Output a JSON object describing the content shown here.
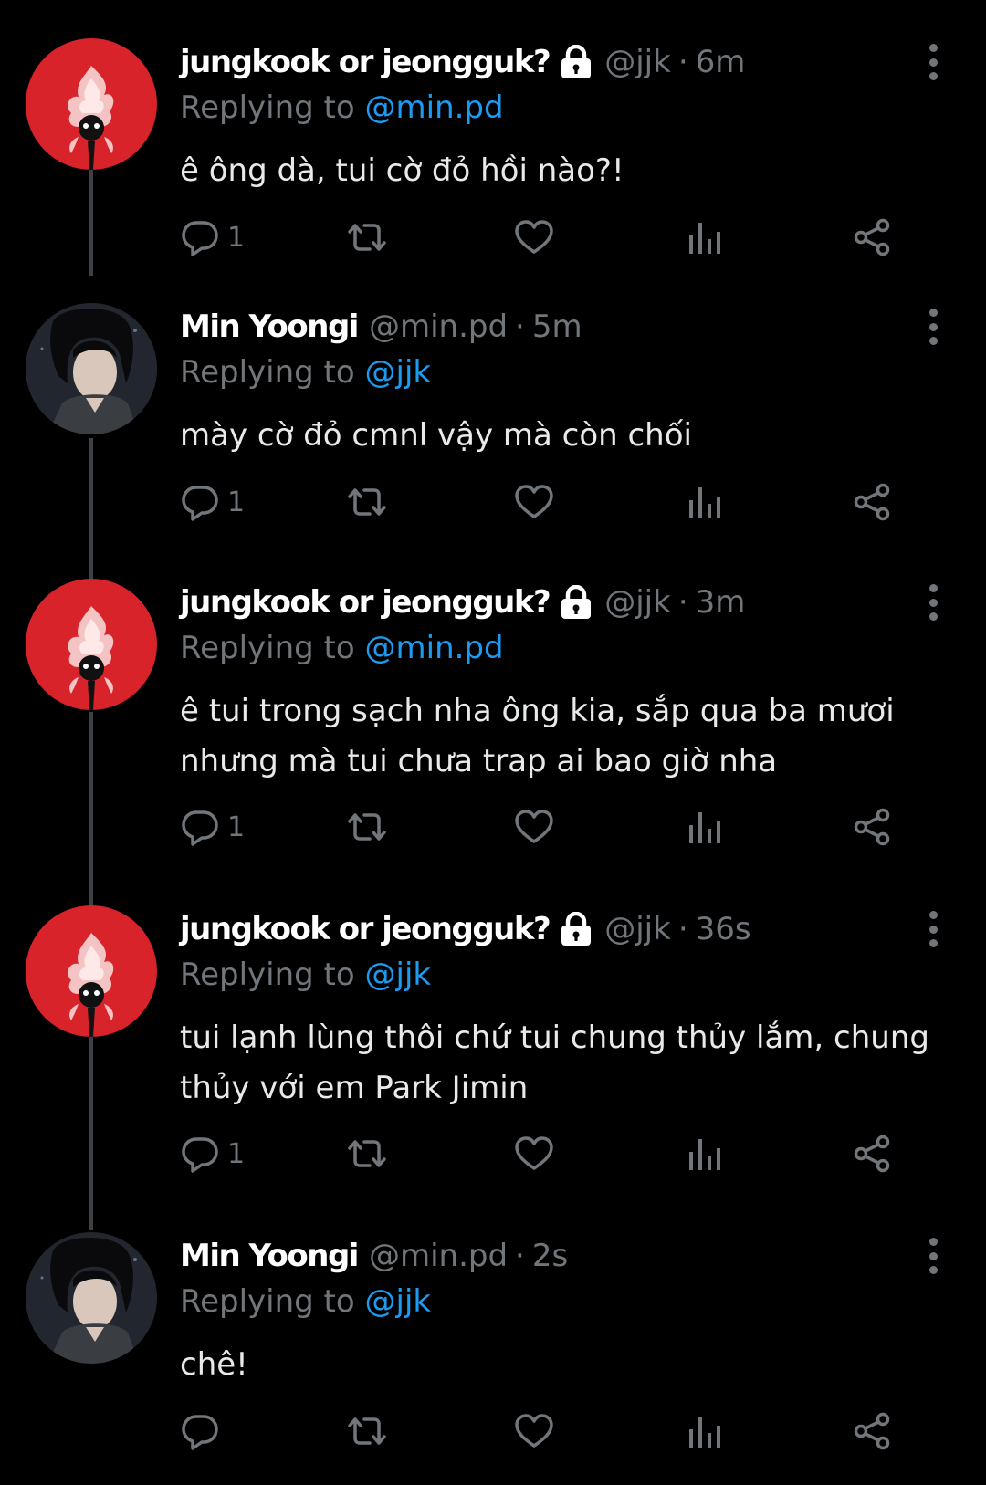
{
  "theme": {
    "background": "#000000",
    "text": "#e7e9ea",
    "muted": "#71767b",
    "link": "#1d9bf0",
    "thread_line": "#3e4144",
    "avatar_red": "#d8232a"
  },
  "tweets": [
    {
      "display_name": "jungkook or jeongguk?",
      "protected": true,
      "handle": "@jjk",
      "dot": "·",
      "time": "6m",
      "replying_prefix": "Replying to ",
      "replying_to": "@min.pd",
      "text": "ê ông dà, tui cờ đỏ hồi nào?!",
      "reply_count": "1",
      "avatar": "red-avatar"
    },
    {
      "display_name": "Min Yoongi",
      "protected": false,
      "handle": "@min.pd",
      "dot": "·",
      "time": "5m",
      "replying_prefix": "Replying to ",
      "replying_to": "@jjk",
      "text": "mày cờ đỏ cmnl vậy mà còn chối",
      "reply_count": "1",
      "avatar": "photo-avatar"
    },
    {
      "display_name": "jungkook or jeongguk?",
      "protected": true,
      "handle": "@jjk",
      "dot": "·",
      "time": "3m",
      "replying_prefix": "Replying to ",
      "replying_to": "@min.pd",
      "text": "ê tui trong sạch nha ông kia, sắp qua ba mươi\nnhưng mà tui chưa trap ai bao giờ nha",
      "reply_count": "1",
      "avatar": "red-avatar"
    },
    {
      "display_name": "jungkook or jeongguk?",
      "protected": true,
      "handle": "@jjk",
      "dot": "·",
      "time": "36s",
      "replying_prefix": "Replying to ",
      "replying_to": "@jjk",
      "text": "tui lạnh lùng thôi chứ tui chung thủy lắm, chung\nthủy với em Park Jimin",
      "reply_count": "1",
      "avatar": "red-avatar"
    },
    {
      "display_name": "Min Yoongi",
      "protected": false,
      "handle": "@min.pd",
      "dot": "·",
      "time": "2s",
      "replying_prefix": "Replying to ",
      "replying_to": "@jjk",
      "text": "chê!",
      "reply_count": "",
      "avatar": "photo-avatar"
    }
  ],
  "icons": {
    "reply": "reply-icon",
    "retweet": "retweet-icon",
    "like": "heart-icon",
    "views": "views-icon",
    "share": "share-icon",
    "more": "more-vertical-icon",
    "protected": "lock-icon"
  }
}
